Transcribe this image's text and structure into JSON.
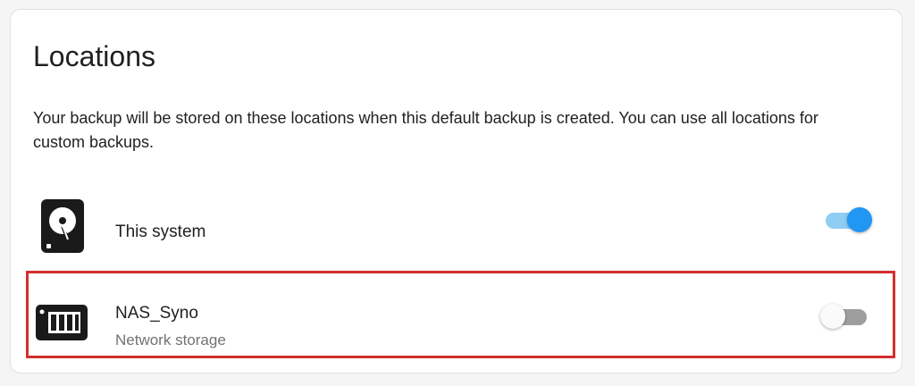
{
  "card": {
    "title": "Locations",
    "description": "Your backup will be stored on these locations when this default backup is created. You can use all locations for custom backups."
  },
  "locations": [
    {
      "icon": "harddisk-icon",
      "title": "This system",
      "subtitle": "",
      "enabled": true
    },
    {
      "icon": "nas-icon",
      "title": "NAS_Syno",
      "subtitle": "Network storage",
      "enabled": false,
      "highlighted": true
    }
  ],
  "colors": {
    "accent": "#2196f3",
    "accent_track": "#8fcdf3",
    "highlight_border": "#d32f2f",
    "toggle_off_track": "#9e9e9e"
  }
}
